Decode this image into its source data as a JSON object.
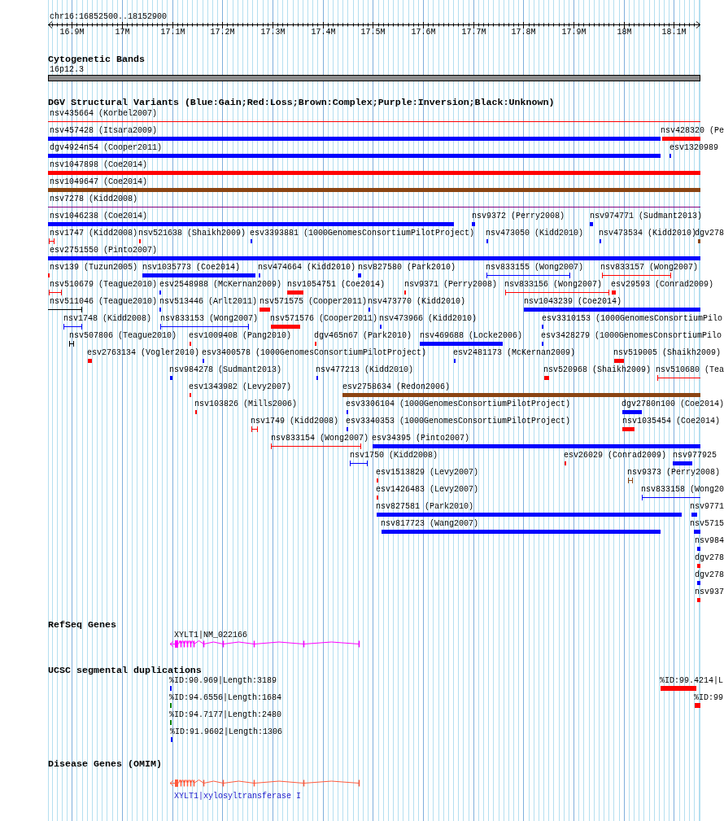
{
  "ruler": {
    "region": "chr16:16852500..18152900",
    "ticks": [
      "16.9M",
      "17M",
      "17.1M",
      "17.2M",
      "17.3M",
      "17.4M",
      "17.5M",
      "17.6M",
      "17.7M",
      "17.8M",
      "17.9M",
      "18M",
      "18.1M"
    ]
  },
  "cytogenetic_bands": {
    "title": "Cytogenetic Bands",
    "bands": [
      {
        "label": "16p12.3"
      }
    ]
  },
  "dgv_variants": {
    "title": "DGV Structural Variants (Blue:Gain;Red:Loss;Brown:Complex;Purple:Inversion;Black:Unknown)",
    "features": [
      {
        "label": "nsv435664 (Korbel2007)",
        "color": "#ff0000",
        "kind": "span"
      },
      {
        "label": "nsv457428 (Itsara2009)",
        "color": "#0000ff",
        "kind": "bar"
      },
      {
        "label": "nsv428320 (Pe",
        "color": "#ff0000",
        "kind": "bar"
      },
      {
        "label": "dgv4924n54 (Cooper2011)",
        "color": "#0000ff",
        "kind": "bar"
      },
      {
        "label": "esv1320989",
        "color": "#0000ff",
        "kind": "bar"
      },
      {
        "label": "nsv1047898 (Coe2014)",
        "color": "#ff0000",
        "kind": "bar"
      },
      {
        "label": "nsv1049647 (Coe2014)",
        "color": "#8b4513",
        "kind": "bar"
      },
      {
        "label": "nsv7278 (Kidd2008)",
        "color": "#800080",
        "kind": "span"
      },
      {
        "label": "nsv1046238 (Coe2014)",
        "color": "#0000ff",
        "kind": "bar"
      },
      {
        "label": "nsv9372 (Perry2008)",
        "color": "#0000ff",
        "kind": "bar"
      },
      {
        "label": "nsv974771 (Sudmant2013)",
        "color": "#0000ff",
        "kind": "bar"
      },
      {
        "label": "nsv1747 (Kidd2008)",
        "color": "#ff0000",
        "kind": "span"
      },
      {
        "label": "nsv521638 (Shaikh2009)",
        "color": "#ff0000",
        "kind": "bar"
      },
      {
        "label": "esv3393881 (1000GenomesConsortiumPilotProject)",
        "color": "#0000ff",
        "kind": "bar"
      },
      {
        "label": "nsv473050 (Kidd2010)",
        "color": "#0000ff",
        "kind": "bar"
      },
      {
        "label": "nsv473534 (Kidd2010)",
        "color": "#0000ff",
        "kind": "bar"
      },
      {
        "label": "dgv278",
        "color": "#8b4513",
        "kind": "bar"
      },
      {
        "label": "esv2751550 (Pinto2007)",
        "color": "#0000ff",
        "kind": "bar"
      },
      {
        "label": "nsv139 (Tuzun2005)",
        "color": "#ff0000",
        "kind": "bar"
      },
      {
        "label": "nsv1035773 (Coe2014)",
        "color": "#0000ff",
        "kind": "bar"
      },
      {
        "label": "nsv474664 (Kidd2010)",
        "color": "#0000ff",
        "kind": "bar"
      },
      {
        "label": "nsv827580 (Park2010)",
        "color": "#0000ff",
        "kind": "bar"
      },
      {
        "label": "nsv833155 (Wong2007)",
        "color": "#0000ff",
        "kind": "span"
      },
      {
        "label": "nsv833157 (Wong2007)",
        "color": "#ff0000",
        "kind": "span"
      },
      {
        "label": "nsv510679 (Teague2010)",
        "color": "#ff0000",
        "kind": "span"
      },
      {
        "label": "esv2548988 (McKernan2009)",
        "color": "#0000ff",
        "kind": "bar"
      },
      {
        "label": "nsv1054751 (Coe2014)",
        "color": "#ff0000",
        "kind": "bar"
      },
      {
        "label": "nsv9371 (Perry2008)",
        "color": "#ff0000",
        "kind": "bar"
      },
      {
        "label": "nsv833156 (Wong2007)",
        "color": "#ff0000",
        "kind": "span"
      },
      {
        "label": "esv29593 (Conrad2009)",
        "color": "#ff0000",
        "kind": "bar"
      },
      {
        "label": "nsv511046 (Teague2010)",
        "color": "#000000",
        "kind": "span"
      },
      {
        "label": "nsv513446 (Arlt2011)",
        "color": "#0000ff",
        "kind": "bar"
      },
      {
        "label": "nsv571575 (Cooper2011)",
        "color": "#ff0000",
        "kind": "bar"
      },
      {
        "label": "nsv473770 (Kidd2010)",
        "color": "#0000ff",
        "kind": "bar"
      },
      {
        "label": "nsv1043239 (Coe2014)",
        "color": "#0000ff",
        "kind": "bar"
      },
      {
        "label": "nsv1748 (Kidd2008)",
        "color": "#0000ff",
        "kind": "span"
      },
      {
        "label": "nsv833153 (Wong2007)",
        "color": "#0000ff",
        "kind": "span"
      },
      {
        "label": "nsv571576 (Cooper2011)",
        "color": "#ff0000",
        "kind": "bar"
      },
      {
        "label": "nsv473966 (Kidd2010)",
        "color": "#0000ff",
        "kind": "bar"
      },
      {
        "label": "esv3310153 (1000GenomesConsortiumPilo",
        "color": "#0000ff",
        "kind": "bar"
      },
      {
        "label": "nsv507806 (Teague2010)",
        "color": "#000000",
        "kind": "span"
      },
      {
        "label": "esv1009408 (Pang2010)",
        "color": "#ff0000",
        "kind": "bar"
      },
      {
        "label": "dgv465n67 (Park2010)",
        "color": "#ff0000",
        "kind": "bar"
      },
      {
        "label": "nsv469688 (Locke2006)",
        "color": "#0000ff",
        "kind": "bar"
      },
      {
        "label": "esv3428279 (1000GenomesConsortiumPilo",
        "color": "#0000ff",
        "kind": "bar"
      },
      {
        "label": "esv2763134 (Vogler2010)",
        "color": "#ff0000",
        "kind": "bar"
      },
      {
        "label": "esv3400578 (1000GenomesConsortiumPilotProject)",
        "color": "#0000ff",
        "kind": "bar"
      },
      {
        "label": "esv2481173 (McKernan2009)",
        "color": "#0000ff",
        "kind": "bar"
      },
      {
        "label": "nsv519005 (Shaikh2009)",
        "color": "#ff0000",
        "kind": "bar"
      },
      {
        "label": "nsv984278 (Sudmant2013)",
        "color": "#0000ff",
        "kind": "bar"
      },
      {
        "label": "nsv477213 (Kidd2010)",
        "color": "#0000ff",
        "kind": "bar"
      },
      {
        "label": "nsv520968 (Shaikh2009)",
        "color": "#ff0000",
        "kind": "bar"
      },
      {
        "label": "nsv510680 (Tea",
        "color": "#ff0000",
        "kind": "span"
      },
      {
        "label": "esv1343982 (Levy2007)",
        "color": "#ff0000",
        "kind": "bar"
      },
      {
        "label": "esv2758634 (Redon2006)",
        "color": "#8b4513",
        "kind": "bar"
      },
      {
        "label": "nsv103826 (Mills2006)",
        "color": "#ff0000",
        "kind": "bar"
      },
      {
        "label": "esv3306104 (1000GenomesConsortiumPilotProject)",
        "color": "#0000ff",
        "kind": "bar"
      },
      {
        "label": "dgv2780n100 (Coe2014)",
        "color": "#0000ff",
        "kind": "bar"
      },
      {
        "label": "nsv1749 (Kidd2008)",
        "color": "#ff0000",
        "kind": "span"
      },
      {
        "label": "esv3340353 (1000GenomesConsortiumPilotProject)",
        "color": "#0000ff",
        "kind": "bar"
      },
      {
        "label": "nsv1035454 (Coe2014)",
        "color": "#ff0000",
        "kind": "bar"
      },
      {
        "label": "nsv833154 (Wong2007)",
        "color": "#ff0000",
        "kind": "span"
      },
      {
        "label": "esv34395 (Pinto2007)",
        "color": "#0000ff",
        "kind": "bar"
      },
      {
        "label": "nsv1750 (Kidd2008)",
        "color": "#0000ff",
        "kind": "span"
      },
      {
        "label": "esv26029 (Conrad2009)",
        "color": "#ff0000",
        "kind": "bar"
      },
      {
        "label": "nsv977925",
        "color": "#0000ff",
        "kind": "bar"
      },
      {
        "label": "esv1513829 (Levy2007)",
        "color": "#ff0000",
        "kind": "bar"
      },
      {
        "label": "nsv9373 (Perry2008)",
        "color": "#8b4513",
        "kind": "span"
      },
      {
        "label": "esv1426483 (Levy2007)",
        "color": "#ff0000",
        "kind": "bar"
      },
      {
        "label": "nsv833158 (Wong20",
        "color": "#0000ff",
        "kind": "span"
      },
      {
        "label": "nsv827581 (Park2010)",
        "color": "#0000ff",
        "kind": "bar"
      },
      {
        "label": "nsv9771",
        "color": "#0000ff",
        "kind": "bar"
      },
      {
        "label": "nsv817723 (Wang2007)",
        "color": "#0000ff",
        "kind": "bar"
      },
      {
        "label": "nsv5715",
        "color": "#0000ff",
        "kind": "bar"
      },
      {
        "label": "nsv984",
        "color": "#0000ff",
        "kind": "bar"
      },
      {
        "label": "dgv278",
        "color": "#ff0000",
        "kind": "bar"
      },
      {
        "label": "dgv278",
        "color": "#0000ff",
        "kind": "bar"
      },
      {
        "label": "nsv937",
        "color": "#ff0000",
        "kind": "bar"
      }
    ]
  },
  "refseq_genes": {
    "title": "RefSeq Genes",
    "genes": [
      {
        "label": "XYLT1|NM_022166"
      }
    ]
  },
  "segmental_duplications": {
    "title": "UCSC segmental duplications",
    "features": [
      {
        "label": "%ID:90.969|Length:3189",
        "color": "#0000ff"
      },
      {
        "label": "%ID:99.4214|L",
        "color": "#ff0000"
      },
      {
        "label": "%ID:94.6556|Length:1684",
        "color": "#008000"
      },
      {
        "label": "%ID:99",
        "color": "#ff0000"
      },
      {
        "label": "%ID:94.7177|Length:2480",
        "color": "#008000"
      },
      {
        "label": "%ID:91.9602|Length:1306",
        "color": "#0000ff"
      }
    ]
  },
  "disease_genes": {
    "title": "Disease Genes (OMIM)",
    "genes": [
      {
        "label": "XYLT1|xylosyltransferase I"
      }
    ]
  }
}
